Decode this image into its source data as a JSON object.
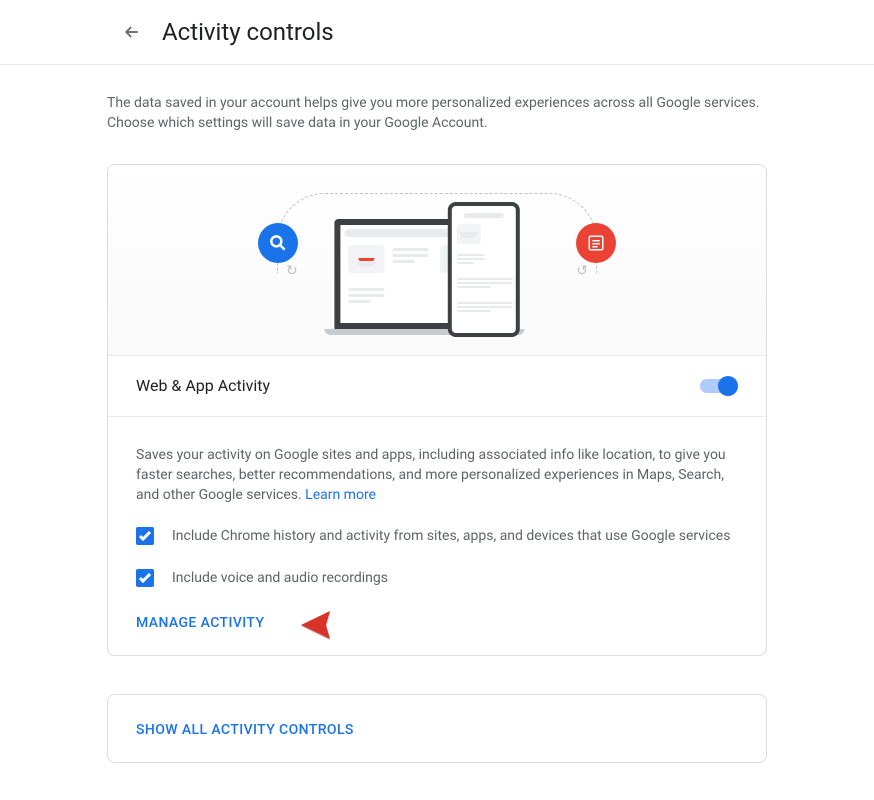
{
  "header": {
    "title": "Activity controls"
  },
  "intro": "The data saved in your account helps give you more personalized experiences across all Google services. Choose which settings will save data in your Google Account.",
  "section": {
    "title": "Web & App Activity",
    "description": "Saves your activity on Google sites and apps, including associated info like location, to give you faster searches, better recommendations, and more personalized experiences in Maps, Search, and other Google services. ",
    "learn_more": "Learn more",
    "checkboxes": [
      "Include Chrome history and activity from sites, apps, and devices that use Google services",
      "Include voice and audio recordings"
    ],
    "manage": "MANAGE ACTIVITY"
  },
  "show_all": "SHOW ALL ACTIVITY CONTROLS"
}
